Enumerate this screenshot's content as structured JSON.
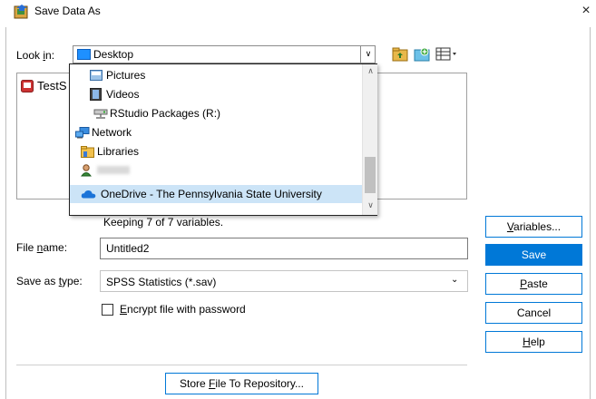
{
  "window": {
    "title": "Save Data As",
    "close_glyph": "×"
  },
  "look_in": {
    "label_pre": "Look ",
    "label_key": "i",
    "label_post": "n:",
    "value": "Desktop",
    "dropdown_arrow": "∨"
  },
  "file_list": {
    "items": [
      {
        "name": "TestS",
        "icon": "spss-file-icon"
      }
    ]
  },
  "dropdown": {
    "items": [
      {
        "label": "Pictures",
        "icon": "pictures-folder-icon"
      },
      {
        "label": "Videos",
        "icon": "videos-folder-icon"
      },
      {
        "label": "RStudio Packages (R:)",
        "icon": "network-drive-icon"
      },
      {
        "label": "Network",
        "icon": "network-icon"
      },
      {
        "label": "Libraries",
        "icon": "libraries-folder-icon"
      },
      {
        "label": "",
        "icon": "user-folder-icon"
      },
      {
        "label": "OneDrive - The Pennsylvania State University",
        "icon": "onedrive-cloud-icon",
        "selected": true
      }
    ]
  },
  "status": {
    "keeping": "Keeping 7 of 7 variables."
  },
  "file_name": {
    "label_pre": "File ",
    "label_key": "n",
    "label_post": "ame:",
    "value": "Untitled2"
  },
  "save_as_type": {
    "label_pre": "Save as ",
    "label_key": "t",
    "label_post": "ype:",
    "value": "SPSS Statistics (*.sav)",
    "arrow": "⌄"
  },
  "encrypt": {
    "label_key": "E",
    "label_post": "ncrypt file with password",
    "checked": false
  },
  "buttons": {
    "variables": {
      "key": "V",
      "rest": "ariables..."
    },
    "save": "Save",
    "paste": {
      "key": "P",
      "rest": "aste"
    },
    "cancel": "Cancel",
    "help": {
      "key": "H",
      "rest": "elp"
    },
    "repository": {
      "pre": "Store ",
      "key": "F",
      "post": "ile To Repository..."
    }
  },
  "colors": {
    "accent": "#0078d7",
    "selection": "#cce4f7"
  }
}
